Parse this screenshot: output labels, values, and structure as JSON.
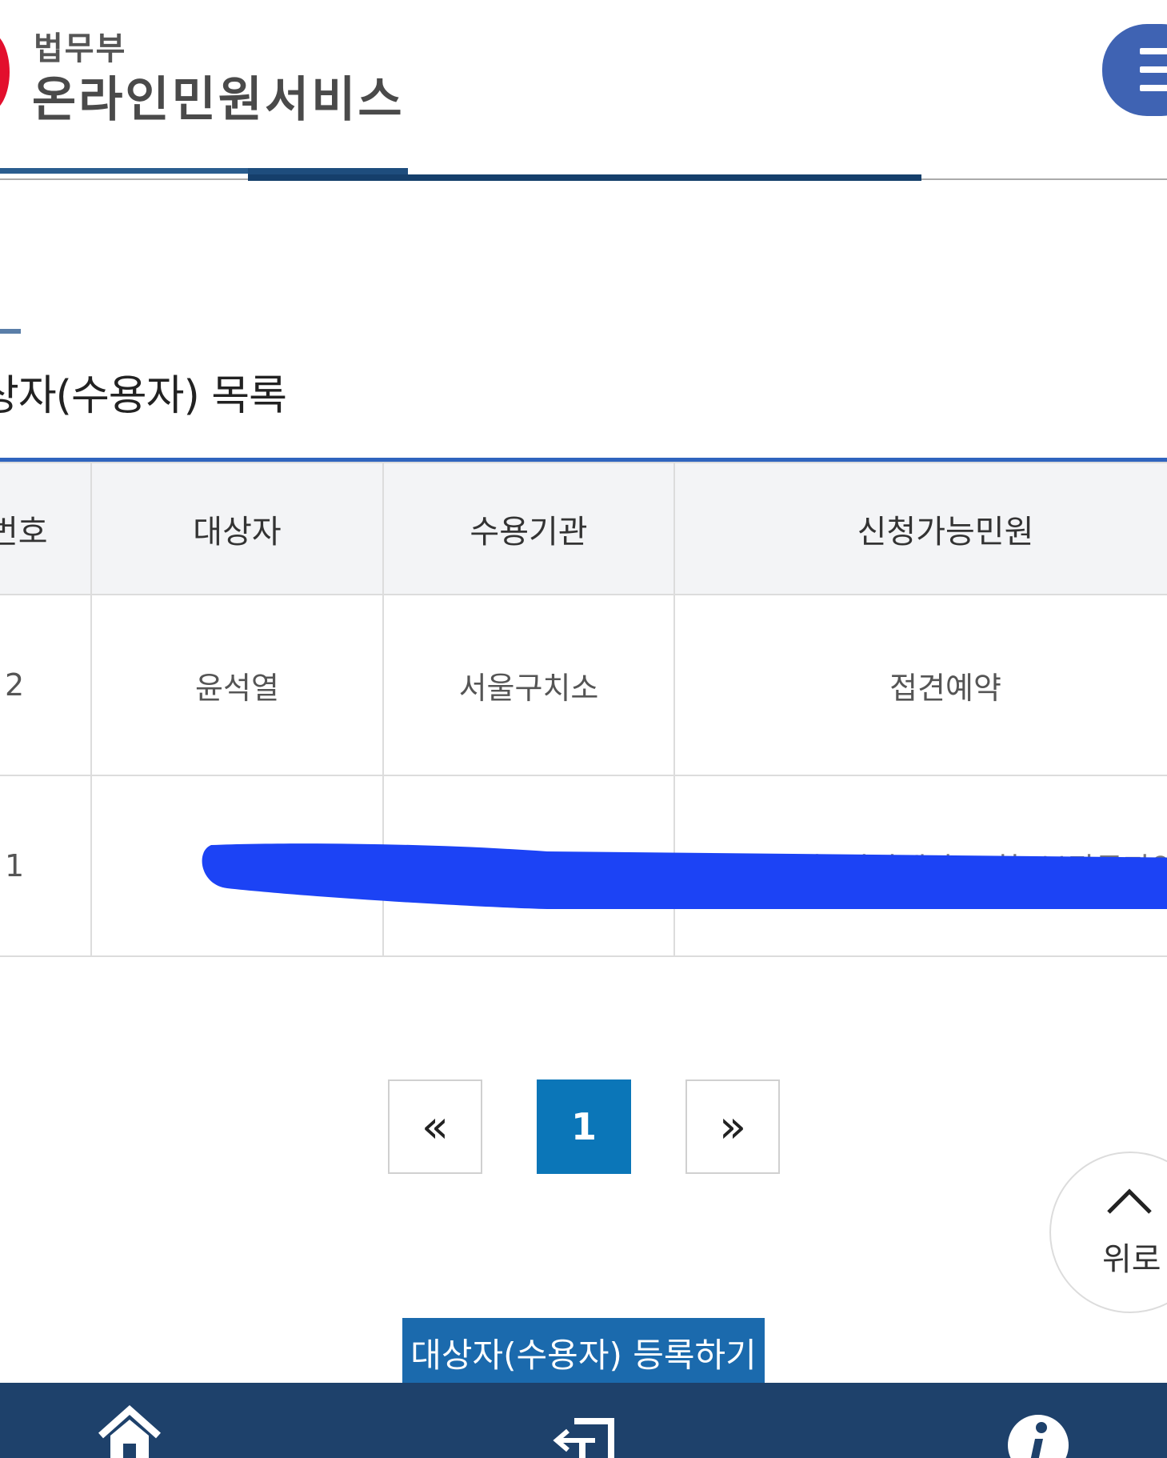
{
  "header": {
    "org_label": "법무부",
    "service_title": "온라인민원서비스",
    "menu_icon": "hamburger-icon",
    "brand_color": "#e30f2d",
    "menu_color": "#3f63b3"
  },
  "section": {
    "title": "상자(수용자) 목록"
  },
  "table": {
    "headers": [
      "번호",
      "대상자",
      "수용기관",
      "신청가능민원"
    ],
    "rows": [
      {
        "no": "2",
        "name": "윤석열",
        "institution": "서울구치소",
        "services": "접견예약"
      },
      {
        "no": "1",
        "name": "",
        "institution": "",
        "services": "접견예약, 가상계좌 조회, 보관금자약"
      }
    ],
    "accent_color": "#2f64be"
  },
  "pagination": {
    "first_label": "«",
    "current_page": "1",
    "last_label": "»",
    "active_color": "#0b76b8"
  },
  "scroll_top": {
    "label": "위로",
    "icon": "chevron-up-icon"
  },
  "register_button": {
    "label": "대상자(수용자) 등록하기",
    "color": "#1b6aad"
  },
  "bottom_nav": {
    "items": [
      {
        "icon": "home-icon"
      },
      {
        "icon": "login-icon"
      },
      {
        "icon": "info-icon"
      }
    ],
    "color": "#1e416b"
  }
}
